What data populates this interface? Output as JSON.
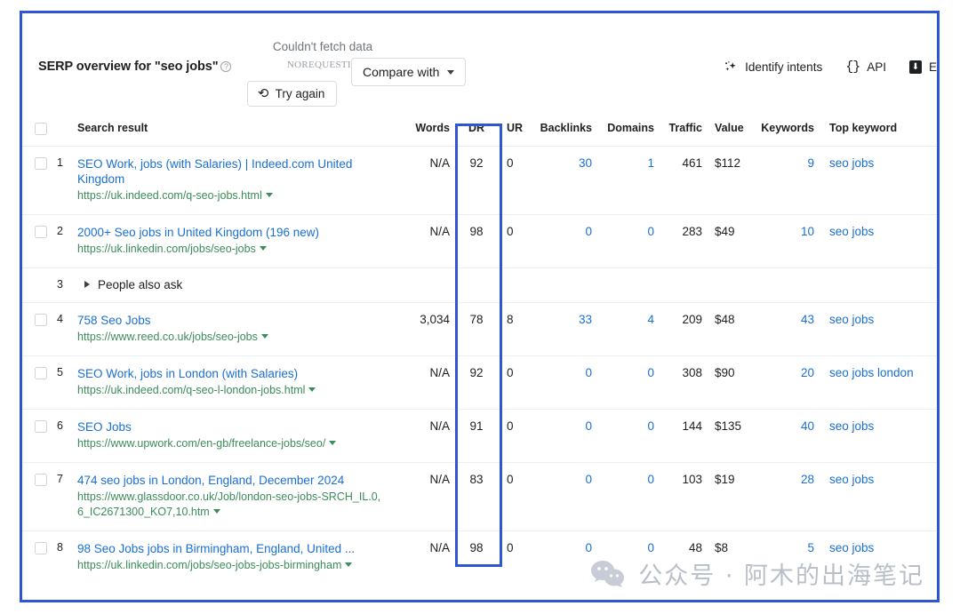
{
  "header": {
    "title": "SERP overview for \"seo jobs\"",
    "help_icon": "question-mark-icon",
    "fetch_error": "Couldn't fetch data",
    "request_id": "NOREQUESTID",
    "try_again_label": "Try again",
    "compare_with_label": "Compare with",
    "actions": [
      {
        "icon": "sparkle-icon",
        "label": "Identify intents"
      },
      {
        "icon": "code-braces-icon",
        "label": "API"
      },
      {
        "icon": "download-icon",
        "label": "E"
      }
    ]
  },
  "table": {
    "columns": {
      "search_result": "Search result",
      "words": "Words",
      "dr": "DR",
      "ur": "UR",
      "backlinks": "Backlinks",
      "domains": "Domains",
      "traffic": "Traffic",
      "value": "Value",
      "keywords": "Keywords",
      "top_keyword": "Top keyword"
    },
    "rows": [
      {
        "rank": "1",
        "type": "result",
        "title": "SEO Work, jobs (with Salaries) | Indeed.com United Kingdom",
        "url": "https://uk.indeed.com/q-seo-jobs.html",
        "words": "N/A",
        "dr": "92",
        "ur": "0",
        "backlinks": "30",
        "domains": "1",
        "traffic": "461",
        "value": "$112",
        "keywords": "9",
        "top_keyword": "seo jobs"
      },
      {
        "rank": "2",
        "type": "result",
        "title": "2000+ Seo jobs in United Kingdom (196 new)",
        "url": "https://uk.linkedin.com/jobs/seo-jobs",
        "words": "N/A",
        "dr": "98",
        "ur": "0",
        "backlinks": "0",
        "domains": "0",
        "traffic": "283",
        "value": "$49",
        "keywords": "10",
        "top_keyword": "seo jobs"
      },
      {
        "rank": "3",
        "type": "feature",
        "title": "People also ask"
      },
      {
        "rank": "4",
        "type": "result",
        "title": "758 Seo Jobs",
        "url": "https://www.reed.co.uk/jobs/seo-jobs",
        "words": "3,034",
        "dr": "78",
        "ur": "8",
        "backlinks": "33",
        "domains": "4",
        "traffic": "209",
        "value": "$48",
        "keywords": "43",
        "top_keyword": "seo jobs"
      },
      {
        "rank": "5",
        "type": "result",
        "title": "SEO Work, jobs in London (with Salaries)",
        "url": "https://uk.indeed.com/q-seo-l-london-jobs.html",
        "words": "N/A",
        "dr": "92",
        "ur": "0",
        "backlinks": "0",
        "domains": "0",
        "traffic": "308",
        "value": "$90",
        "keywords": "20",
        "top_keyword": "seo jobs london"
      },
      {
        "rank": "6",
        "type": "result",
        "title": "SEO Jobs",
        "url": "https://www.upwork.com/en-gb/freelance-jobs/seo/",
        "words": "N/A",
        "dr": "91",
        "ur": "0",
        "backlinks": "0",
        "domains": "0",
        "traffic": "144",
        "value": "$135",
        "keywords": "40",
        "top_keyword": "seo jobs"
      },
      {
        "rank": "7",
        "type": "result",
        "title": "474 seo jobs in London, England, December 2024",
        "url": "https://www.glassdoor.co.uk/Job/london-seo-jobs-SRCH_IL.0,6_IC2671300_KO7,10.htm",
        "words": "N/A",
        "dr": "83",
        "ur": "0",
        "backlinks": "0",
        "domains": "0",
        "traffic": "103",
        "value": "$19",
        "keywords": "28",
        "top_keyword": "seo jobs"
      },
      {
        "rank": "8",
        "type": "result",
        "title": "98 Seo Jobs jobs in Birmingham, England, United ...",
        "url": "https://uk.linkedin.com/jobs/seo-jobs-jobs-birmingham",
        "words": "N/A",
        "dr": "98",
        "ur": "0",
        "backlinks": "0",
        "domains": "0",
        "traffic": "48",
        "value": "$8",
        "keywords": "5",
        "top_keyword": "seo jobs"
      }
    ]
  },
  "annotations": {
    "frame_color": "#2f55d4",
    "dr_highlight_color": "#2f55d4"
  },
  "watermark": {
    "icon": "wechat-icon",
    "text": "公众号 · 阿木的出海笔记"
  }
}
